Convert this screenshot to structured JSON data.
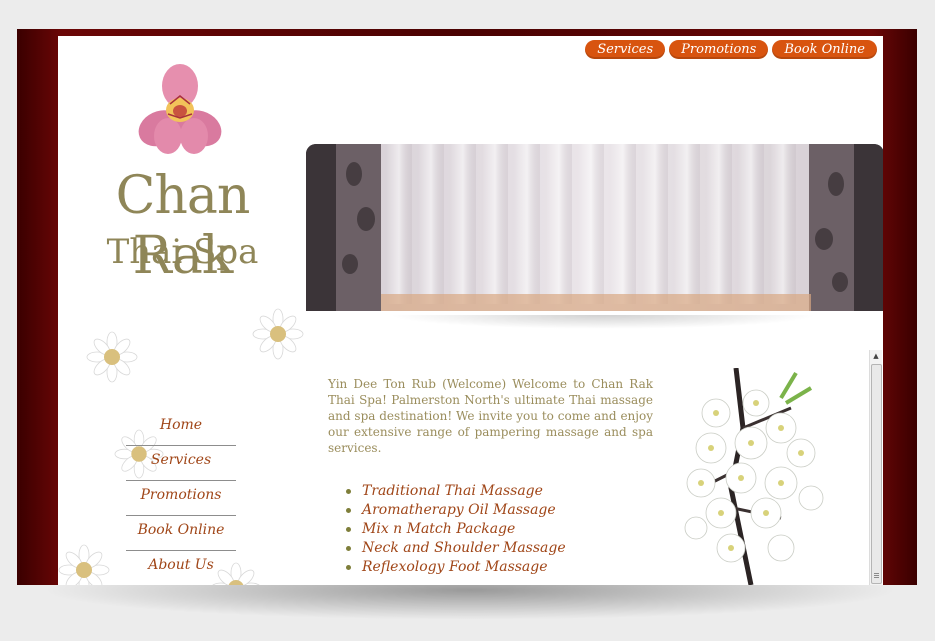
{
  "top_nav": [
    "Services",
    "Promotions",
    "Book Online"
  ],
  "logo": {
    "title": "Chan Rak",
    "subtitle": "Thai Spa"
  },
  "side_nav": [
    "Home",
    "Services",
    "Promotions",
    "Book Online",
    "About Us"
  ],
  "content": {
    "welcome": "Yin Dee Ton Rub (Welcome) Welcome to Chan Rak Thai Spa! Palmerston North's ultimate Thai massage and spa destination! We invite you to come and enjoy our extensive range of pampering massage and spa services.",
    "services": [
      "Traditional Thai Massage",
      "Aromatherapy Oil Massage",
      "Mix n Match Package",
      "Neck and Shoulder Massage",
      "Reflexology Foot Massage"
    ]
  },
  "colors": {
    "accent": "#d8540f",
    "link": "#a04618",
    "logo_text": "#8f8658",
    "frame": "#5a0303"
  }
}
